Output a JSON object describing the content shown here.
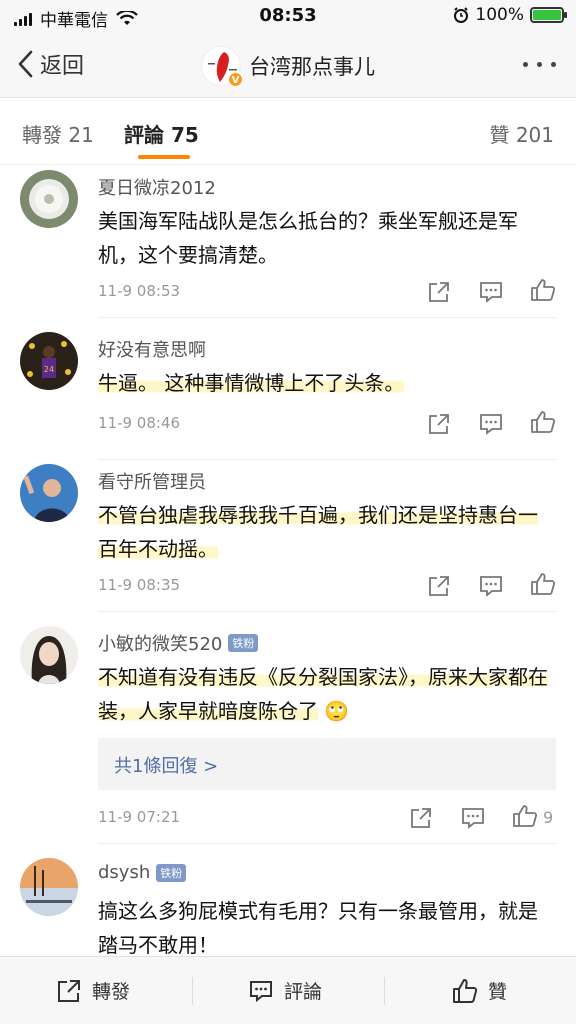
{
  "status_bar": {
    "carrier": "中華電信",
    "time": "08:53",
    "battery": "100%"
  },
  "nav": {
    "back_label": "返回",
    "title": "台湾那点事儿",
    "logo_badge": "V"
  },
  "tabs": {
    "repost": "轉發 21",
    "comments": "評論 75",
    "likes": "贊 201"
  },
  "comments": [
    {
      "username": "夏日微凉2012",
      "text": "美国海军陆战队是怎么抵台的？乘坐军舰还是军机，这个要搞清楚。",
      "time": "11-9 08:53"
    },
    {
      "username": "好没有意思啊",
      "text": "牛逼。 这种事情微博上不了头条。",
      "time": "11-9 08:46"
    },
    {
      "username": "看守所管理员",
      "text": "不管台独虐我辱我我千百遍，我们还是坚持惠台一百年不动摇。",
      "time": "11-9 08:35"
    },
    {
      "username": "小敏的微笑520",
      "badge": "铁粉",
      "text": "不知道有没有违反《反分裂国家法》，原来大家都在装，人家早就暗度陈仓了",
      "emoji": "🙄",
      "reply_link": "共1條回復 >",
      "time": "11-9 07:21",
      "likes": "9"
    },
    {
      "username": "dsysh",
      "badge": "铁粉",
      "text": "搞这么多狗屁模式有毛用？只有一条最管用，就是踏马不敢用！"
    }
  ],
  "bottom_bar": {
    "repost": "轉發",
    "comment": "評論",
    "like": "贊"
  },
  "colors": {
    "accent": "#ff8200",
    "link": "#506ea7",
    "badge": "#7f9ac9",
    "battery": "#37c43d"
  }
}
